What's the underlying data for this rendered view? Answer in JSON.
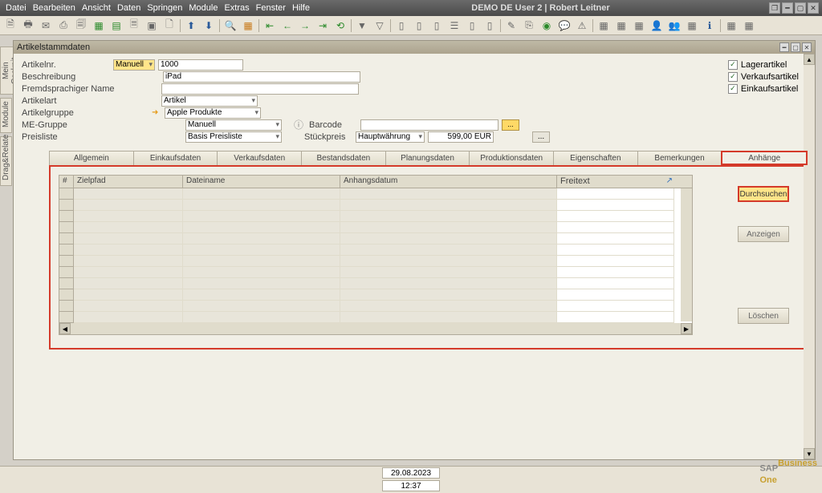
{
  "menubar": {
    "items": [
      "Datei",
      "Bearbeiten",
      "Ansicht",
      "Daten",
      "Springen",
      "Module",
      "Extras",
      "Fenster",
      "Hilfe"
    ]
  },
  "title": "DEMO DE User 2 | Robert Leitner",
  "side_tabs": {
    "cockpit": "Mein Cockpit",
    "module": "Module",
    "dragrelate": "Drag&Relate"
  },
  "window": {
    "title": "Artikelstammdaten"
  },
  "form": {
    "artikelnr_label": "Artikelnr.",
    "artikelnr_mode": "Manuell",
    "artikelnr_value": "1000",
    "beschreibung_label": "Beschreibung",
    "beschreibung_value": "iPad",
    "fremdname_label": "Fremdsprachiger Name",
    "artikelart_label": "Artikelart",
    "artikelart_value": "Artikel",
    "artikelgruppe_label": "Artikelgruppe",
    "artikelgruppe_value": "Apple Produkte",
    "megruppe_label": "ME-Gruppe",
    "megruppe_value": "Manuell",
    "preisliste_label": "Preisliste",
    "preisliste_value": "Basis Preisliste",
    "barcode_label": "Barcode",
    "stueckpreis_label": "Stückpreis",
    "stueckpreis_curr": "Hauptwährung",
    "stueckpreis_value": "599,00 EUR"
  },
  "checkboxes": {
    "lager": "Lagerartikel",
    "verkauf": "Verkaufsartikel",
    "einkauf": "Einkaufsartikel"
  },
  "tabs": [
    "Allgemein",
    "Einkaufsdaten",
    "Verkaufsdaten",
    "Bestandsdaten",
    "Planungsdaten",
    "Produktionsdaten",
    "Eigenschaften",
    "Bemerkungen",
    "Anhänge"
  ],
  "active_tab": 8,
  "grid": {
    "headers": {
      "num": "#",
      "c1": "Zielpfad",
      "c2": "Dateiname",
      "c3": "Anhangsdatum",
      "c4": "Freitext"
    }
  },
  "buttons": {
    "durchsuchen": "Durchsuchen",
    "anzeigen": "Anzeigen",
    "loeschen": "Löschen"
  },
  "status": {
    "date": "29.08.2023",
    "time": "12:37"
  },
  "logo": {
    "sap": "SAP",
    "suffix": "Business",
    "one": "One"
  }
}
